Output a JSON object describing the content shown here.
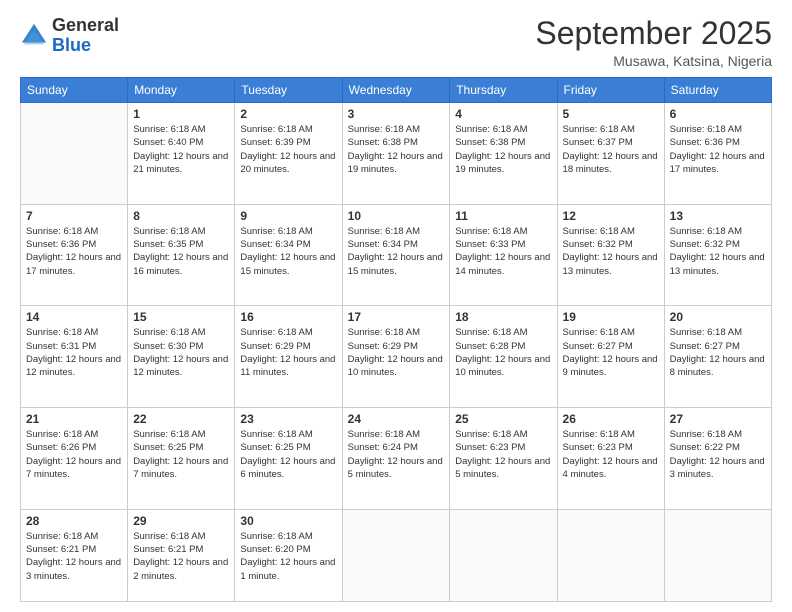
{
  "logo": {
    "general": "General",
    "blue": "Blue"
  },
  "header": {
    "month_year": "September 2025",
    "location": "Musawa, Katsina, Nigeria"
  },
  "days_of_week": [
    "Sunday",
    "Monday",
    "Tuesday",
    "Wednesday",
    "Thursday",
    "Friday",
    "Saturday"
  ],
  "weeks": [
    [
      {
        "day": "",
        "info": ""
      },
      {
        "day": "1",
        "info": "Sunrise: 6:18 AM\nSunset: 6:40 PM\nDaylight: 12 hours\nand 21 minutes."
      },
      {
        "day": "2",
        "info": "Sunrise: 6:18 AM\nSunset: 6:39 PM\nDaylight: 12 hours\nand 20 minutes."
      },
      {
        "day": "3",
        "info": "Sunrise: 6:18 AM\nSunset: 6:38 PM\nDaylight: 12 hours\nand 19 minutes."
      },
      {
        "day": "4",
        "info": "Sunrise: 6:18 AM\nSunset: 6:38 PM\nDaylight: 12 hours\nand 19 minutes."
      },
      {
        "day": "5",
        "info": "Sunrise: 6:18 AM\nSunset: 6:37 PM\nDaylight: 12 hours\nand 18 minutes."
      },
      {
        "day": "6",
        "info": "Sunrise: 6:18 AM\nSunset: 6:36 PM\nDaylight: 12 hours\nand 17 minutes."
      }
    ],
    [
      {
        "day": "7",
        "info": "Sunrise: 6:18 AM\nSunset: 6:36 PM\nDaylight: 12 hours\nand 17 minutes."
      },
      {
        "day": "8",
        "info": "Sunrise: 6:18 AM\nSunset: 6:35 PM\nDaylight: 12 hours\nand 16 minutes."
      },
      {
        "day": "9",
        "info": "Sunrise: 6:18 AM\nSunset: 6:34 PM\nDaylight: 12 hours\nand 15 minutes."
      },
      {
        "day": "10",
        "info": "Sunrise: 6:18 AM\nSunset: 6:34 PM\nDaylight: 12 hours\nand 15 minutes."
      },
      {
        "day": "11",
        "info": "Sunrise: 6:18 AM\nSunset: 6:33 PM\nDaylight: 12 hours\nand 14 minutes."
      },
      {
        "day": "12",
        "info": "Sunrise: 6:18 AM\nSunset: 6:32 PM\nDaylight: 12 hours\nand 13 minutes."
      },
      {
        "day": "13",
        "info": "Sunrise: 6:18 AM\nSunset: 6:32 PM\nDaylight: 12 hours\nand 13 minutes."
      }
    ],
    [
      {
        "day": "14",
        "info": "Sunrise: 6:18 AM\nSunset: 6:31 PM\nDaylight: 12 hours\nand 12 minutes."
      },
      {
        "day": "15",
        "info": "Sunrise: 6:18 AM\nSunset: 6:30 PM\nDaylight: 12 hours\nand 12 minutes."
      },
      {
        "day": "16",
        "info": "Sunrise: 6:18 AM\nSunset: 6:29 PM\nDaylight: 12 hours\nand 11 minutes."
      },
      {
        "day": "17",
        "info": "Sunrise: 6:18 AM\nSunset: 6:29 PM\nDaylight: 12 hours\nand 10 minutes."
      },
      {
        "day": "18",
        "info": "Sunrise: 6:18 AM\nSunset: 6:28 PM\nDaylight: 12 hours\nand 10 minutes."
      },
      {
        "day": "19",
        "info": "Sunrise: 6:18 AM\nSunset: 6:27 PM\nDaylight: 12 hours\nand 9 minutes."
      },
      {
        "day": "20",
        "info": "Sunrise: 6:18 AM\nSunset: 6:27 PM\nDaylight: 12 hours\nand 8 minutes."
      }
    ],
    [
      {
        "day": "21",
        "info": "Sunrise: 6:18 AM\nSunset: 6:26 PM\nDaylight: 12 hours\nand 7 minutes."
      },
      {
        "day": "22",
        "info": "Sunrise: 6:18 AM\nSunset: 6:25 PM\nDaylight: 12 hours\nand 7 minutes."
      },
      {
        "day": "23",
        "info": "Sunrise: 6:18 AM\nSunset: 6:25 PM\nDaylight: 12 hours\nand 6 minutes."
      },
      {
        "day": "24",
        "info": "Sunrise: 6:18 AM\nSunset: 6:24 PM\nDaylight: 12 hours\nand 5 minutes."
      },
      {
        "day": "25",
        "info": "Sunrise: 6:18 AM\nSunset: 6:23 PM\nDaylight: 12 hours\nand 5 minutes."
      },
      {
        "day": "26",
        "info": "Sunrise: 6:18 AM\nSunset: 6:23 PM\nDaylight: 12 hours\nand 4 minutes."
      },
      {
        "day": "27",
        "info": "Sunrise: 6:18 AM\nSunset: 6:22 PM\nDaylight: 12 hours\nand 3 minutes."
      }
    ],
    [
      {
        "day": "28",
        "info": "Sunrise: 6:18 AM\nSunset: 6:21 PM\nDaylight: 12 hours\nand 3 minutes."
      },
      {
        "day": "29",
        "info": "Sunrise: 6:18 AM\nSunset: 6:21 PM\nDaylight: 12 hours\nand 2 minutes."
      },
      {
        "day": "30",
        "info": "Sunrise: 6:18 AM\nSunset: 6:20 PM\nDaylight: 12 hours\nand 1 minute."
      },
      {
        "day": "",
        "info": ""
      },
      {
        "day": "",
        "info": ""
      },
      {
        "day": "",
        "info": ""
      },
      {
        "day": "",
        "info": ""
      }
    ]
  ]
}
